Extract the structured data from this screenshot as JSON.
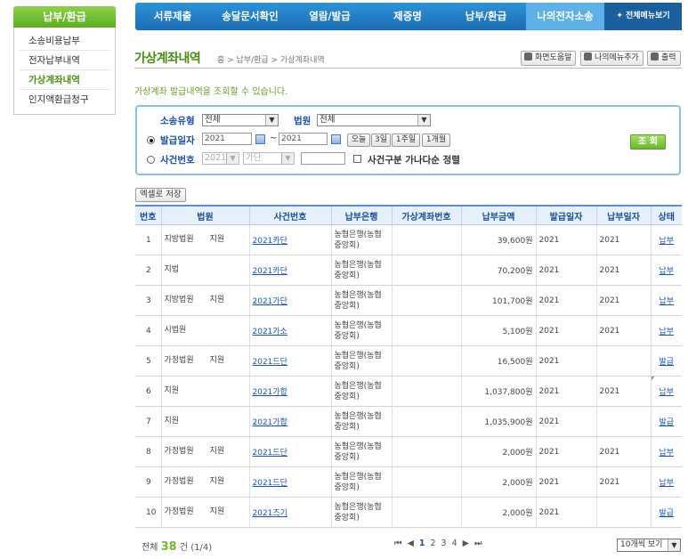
{
  "sidebar": {
    "title": "납부/환급",
    "items": [
      "소송비용납부",
      "전자납부내역",
      "가상계좌내역",
      "인지액환급청구"
    ]
  },
  "topnav": {
    "items": [
      "서류제출",
      "송달문서확인",
      "열람/발급",
      "제증명",
      "납부/환급",
      "나의전자소송"
    ],
    "all_menu": "✦ 전체메뉴보기"
  },
  "page": {
    "title": "가상계좌내역",
    "breadcrumb": "홈 > 납부/환급 > 가상계좌내역",
    "help_label": "화면도움말",
    "mymenu_label": "나의메뉴추가",
    "print_label": "출력",
    "description": "가상계좌 발급내역을 조회할 수 있습니다."
  },
  "search": {
    "type_label": "소송유형",
    "type_value": "전체",
    "court_label": "법원",
    "court_value": "전체",
    "date_label": "발급일자",
    "date_from": "2021",
    "date_sep": "~",
    "date_to": "2021",
    "quick": [
      "오늘",
      "3일",
      "1주일",
      "1개월"
    ],
    "case_label": "사건번호",
    "case_year": "2021",
    "case_type": "가단",
    "sort_label": "사건구분 가나다순 정렬",
    "search_button": "조 회"
  },
  "excel_button": "엑셀로 저장",
  "table": {
    "headers": [
      "번호",
      "법원",
      "사건번호",
      "납부은행",
      "가상계좌번호",
      "납부금액",
      "발급일자",
      "납부일자",
      "상태"
    ],
    "rows": [
      {
        "no": "1",
        "court": "지방법원　　지원",
        "case": "2021카단",
        "bank": "농협은행(농협중앙회)",
        "account": "",
        "amount": "39,600원",
        "issue": "2021",
        "paid": "2021",
        "status": "납부"
      },
      {
        "no": "2",
        "court": "지법",
        "case": "2021카단",
        "bank": "농협은행(농협중앙회)",
        "account": "",
        "amount": "70,200원",
        "issue": "2021",
        "paid": "2021",
        "status": "납부"
      },
      {
        "no": "3",
        "court": "지방법원　　지원",
        "case": "2021가단",
        "bank": "농협은행(농협중앙회)",
        "account": "",
        "amount": "101,700원",
        "issue": "2021",
        "paid": "2021",
        "status": "납부"
      },
      {
        "no": "4",
        "court": "시법원",
        "case": "2021가소",
        "bank": "농협은행(농협중앙회)",
        "account": "",
        "amount": "5,100원",
        "issue": "2021",
        "paid": "2021",
        "status": "납부"
      },
      {
        "no": "5",
        "court": "가정법원　　지원",
        "case": "2021드단",
        "bank": "농협은행(농협중앙회)",
        "account": "",
        "amount": "16,500원",
        "issue": "2021",
        "paid": "",
        "status": "발급"
      },
      {
        "no": "6",
        "court": "지원",
        "case": "2021가합",
        "bank": "농협은행(농협중앙회)",
        "account": "",
        "amount": "1,037,800원",
        "issue": "2021",
        "paid": "2021",
        "status": "납부"
      },
      {
        "no": "7",
        "court": "지원",
        "case": "2021가합",
        "bank": "농협은행(농협중앙회)",
        "account": "",
        "amount": "1,035,900원",
        "issue": "2021",
        "paid": "",
        "status": "발급"
      },
      {
        "no": "8",
        "court": "가정법원　　지원",
        "case": "2021드단",
        "bank": "농협은행(농협중앙회)",
        "account": "",
        "amount": "2,000원",
        "issue": "2021",
        "paid": "2021",
        "status": "납부"
      },
      {
        "no": "9",
        "court": "가정법원　　지원",
        "case": "2021드단",
        "bank": "농협은행(농협중앙회)",
        "account": "",
        "amount": "2,000원",
        "issue": "2021",
        "paid": "2021",
        "status": "납부"
      },
      {
        "no": "10",
        "court": "가정법원　　지원",
        "case": "2021즈기",
        "bank": "농협은행(농협중앙회)",
        "account": "",
        "amount": "2,000원",
        "issue": "2021",
        "paid": "",
        "status": "발급"
      }
    ]
  },
  "footer": {
    "total_prefix": "전체",
    "total_count": "38",
    "total_suffix": "건 (1/4)",
    "pages": [
      "1",
      "2",
      "3",
      "4"
    ],
    "per_page": "10개씩 보기"
  },
  "colors": {
    "accent_green": "#7ab82e",
    "nav_blue": "#1b6db5",
    "link_blue": "#1a55b6"
  },
  "icons": {
    "check": "check-icon"
  }
}
